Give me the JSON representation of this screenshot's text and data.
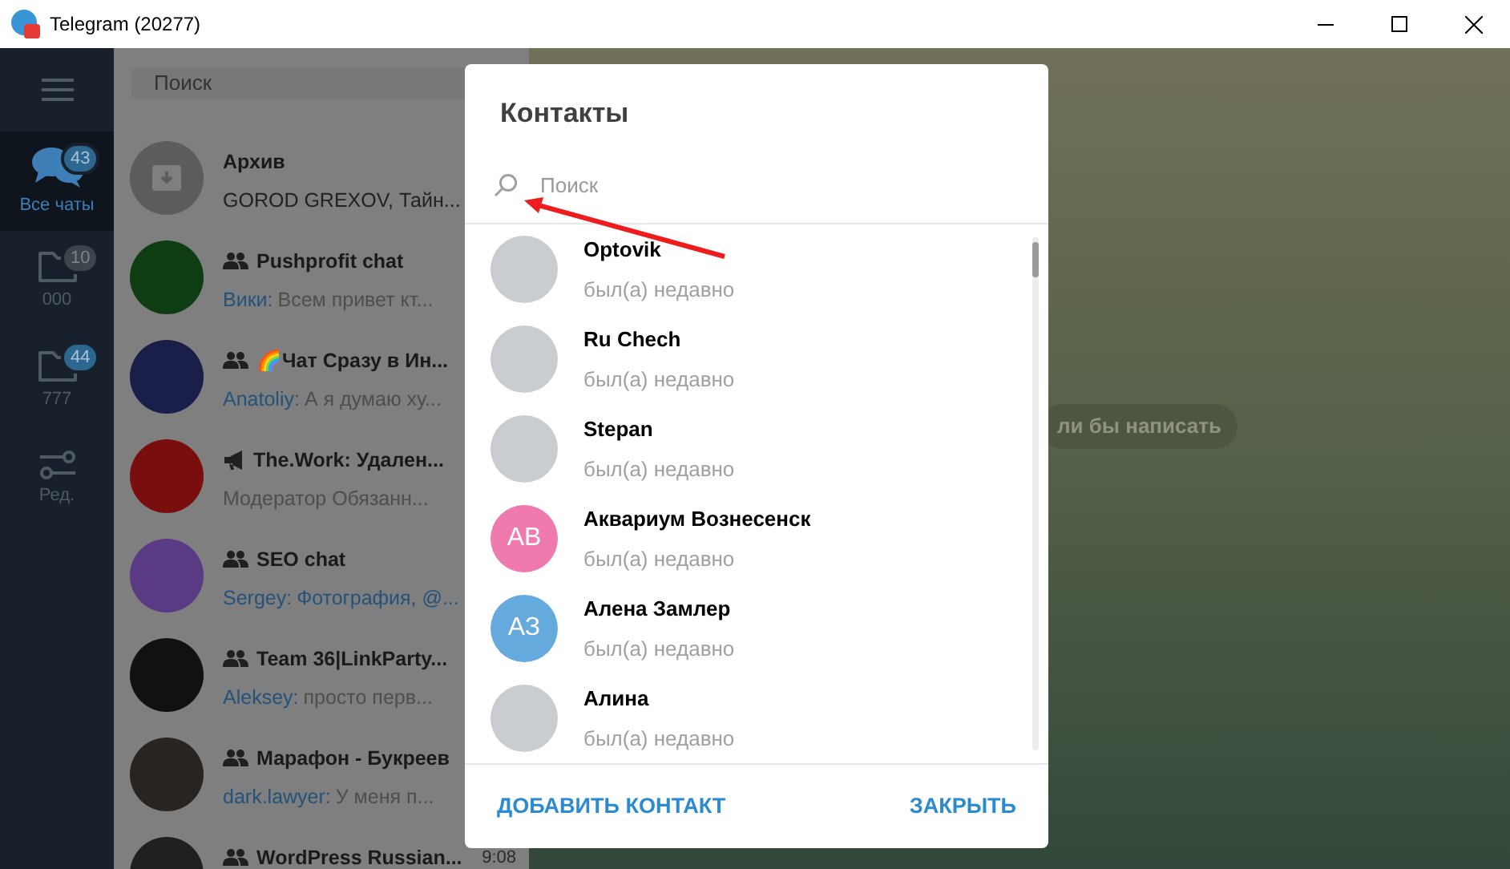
{
  "window": {
    "title": "Telegram (20277)"
  },
  "folders": [
    {
      "kind": "chats",
      "label": "Все чаты",
      "badge": "43",
      "badge_muted": false,
      "selected": true
    },
    {
      "kind": "folder",
      "label": "000",
      "badge": "10",
      "badge_muted": true,
      "selected": false
    },
    {
      "kind": "folder",
      "label": "777",
      "badge": "44",
      "badge_muted": false,
      "selected": false
    },
    {
      "kind": "edit",
      "label": "Ред.",
      "selected": false
    }
  ],
  "chat_search": {
    "placeholder": "Поиск"
  },
  "chats": [
    {
      "kind": "archive",
      "title": "Архив",
      "preview": "GOROD GREXOV, Тайн..."
    },
    {
      "kind": "group",
      "title": "Pushprofit chat",
      "sender": "Вики:",
      "preview": "Всем привет кт...",
      "media": false,
      "color": "#0f3d12"
    },
    {
      "kind": "group",
      "title": "🌈Чат Сразу в Ин...",
      "sender": "Anatoliy:",
      "preview": "А я думаю ху...",
      "media": false,
      "color": "#1a1f4a"
    },
    {
      "kind": "channel",
      "title": "The.Work: Удален...",
      "preview": "Модератор  Обязанн...",
      "media": false,
      "color": "#7a0d0d"
    },
    {
      "kind": "group",
      "title": "SEO chat",
      "sender": "Sergey:",
      "preview": "Фотография, @...",
      "media": true,
      "color": "#5b3a85"
    },
    {
      "kind": "group",
      "title": "Team 36|LinkParty...",
      "sender": "Aleksey:",
      "preview": "просто перв...",
      "media": false,
      "color": "#111111"
    },
    {
      "kind": "group",
      "title": "Марафон - Букреев",
      "sender": "dark.lawyer:",
      "preview": "У меня п...",
      "media": false,
      "color": "#2a2420"
    },
    {
      "kind": "group",
      "title": "WordPress Russian...",
      "time": "9:08",
      "color": "#202020"
    }
  ],
  "background": {
    "hint": "ли бы написать"
  },
  "dialog": {
    "title": "Контакты",
    "search": {
      "placeholder": "Поиск"
    },
    "contacts": [
      {
        "name": "Optovik",
        "status": "был(а) недавно"
      },
      {
        "name": "Ru Chech",
        "status": "был(а) недавно"
      },
      {
        "name": "Stepan",
        "status": "был(а) недавно"
      },
      {
        "name": "Аквариум Вознесенск",
        "status": "был(а) недавно",
        "initials": "АВ",
        "color": "#ee7aae"
      },
      {
        "name": "Алена Замлер",
        "status": "был(а) недавно",
        "initials": "АЗ",
        "color": "#65aadd"
      },
      {
        "name": "Алина",
        "status": "был(а) недавно"
      }
    ],
    "buttons": [
      "ДОБАВИТЬ КОНТАКТ",
      "ЗАКРЫТЬ"
    ]
  }
}
